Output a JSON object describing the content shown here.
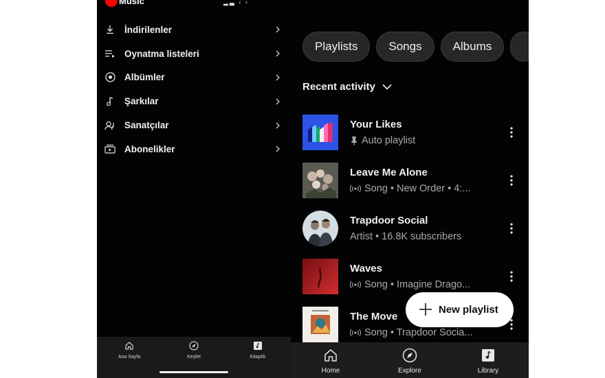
{
  "left_panel": {
    "app_name": "Music",
    "menu": [
      {
        "label": "İndirilenler",
        "icon": "download-icon"
      },
      {
        "label": "Oynatma listeleri",
        "icon": "playlist-icon"
      },
      {
        "label": "Albümler",
        "icon": "album-icon"
      },
      {
        "label": "Şarkılar",
        "icon": "music-note-icon"
      },
      {
        "label": "Sanatçılar",
        "icon": "artist-icon"
      },
      {
        "label": "Abonelikler",
        "icon": "subscriptions-icon"
      }
    ],
    "nav": [
      {
        "label": "Ana Sayfa",
        "icon": "home-icon"
      },
      {
        "label": "Keşfet",
        "icon": "compass-icon"
      },
      {
        "label": "Kitaplık",
        "icon": "library-icon"
      }
    ]
  },
  "right_panel": {
    "chips": [
      "Playlists",
      "Songs",
      "Albums"
    ],
    "recent_label": "Recent activity",
    "items": [
      {
        "title": "Your Likes",
        "subtitle": "Auto playlist",
        "sub_icon": "pin-icon"
      },
      {
        "title": "Leave Me Alone",
        "subtitle": "Song • New Order • 4:...",
        "sub_icon": "radio-icon"
      },
      {
        "title": "Trapdoor Social",
        "subtitle": "Artist • 16.8K subscribers",
        "sub_icon": ""
      },
      {
        "title": "Waves",
        "subtitle": "Song • Imagine Drago...",
        "sub_icon": "radio-icon"
      },
      {
        "title": "The Move",
        "subtitle": "Song • Trapdoor Socia...",
        "sub_icon": "radio-icon"
      }
    ],
    "fab_label": "New playlist",
    "nav": [
      {
        "label": "Home",
        "icon": "home-icon"
      },
      {
        "label": "Explore",
        "icon": "compass-icon"
      },
      {
        "label": "Library",
        "icon": "library-icon"
      }
    ]
  },
  "colors": {
    "background": "#030303",
    "chip": "#272727",
    "brand_red": "#ff0000",
    "secondary_text": "#aaaaaa",
    "nav_bar": "#1d1d1d"
  }
}
